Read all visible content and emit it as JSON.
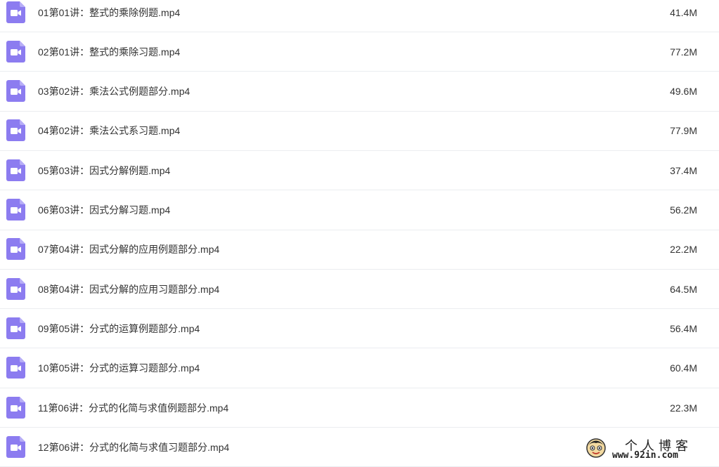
{
  "file_list": {
    "files": [
      {
        "name": "01第01讲：整式的乘除例题.mp4",
        "size": "41.4M",
        "icon": "video-file-icon"
      },
      {
        "name": "02第01讲：整式的乘除习题.mp4",
        "size": "77.2M",
        "icon": "video-file-icon"
      },
      {
        "name": "03第02讲：乘法公式例题部分.mp4",
        "size": "49.6M",
        "icon": "video-file-icon"
      },
      {
        "name": "04第02讲：乘法公式系习题.mp4",
        "size": "77.9M",
        "icon": "video-file-icon"
      },
      {
        "name": "05第03讲：因式分解例题.mp4",
        "size": "37.4M",
        "icon": "video-file-icon"
      },
      {
        "name": "06第03讲：因式分解习题.mp4",
        "size": "56.2M",
        "icon": "video-file-icon"
      },
      {
        "name": "07第04讲：因式分解的应用例题部分.mp4",
        "size": "22.2M",
        "icon": "video-file-icon"
      },
      {
        "name": "08第04讲：因式分解的应用习题部分.mp4",
        "size": "64.5M",
        "icon": "video-file-icon"
      },
      {
        "name": "09第05讲：分式的运算例题部分.mp4",
        "size": "56.4M",
        "icon": "video-file-icon"
      },
      {
        "name": "10第05讲：分式的运算习题部分.mp4",
        "size": "60.4M",
        "icon": "video-file-icon"
      },
      {
        "name": "11第06讲：分式的化简与求值例题部分.mp4",
        "size": "22.3M",
        "icon": "video-file-icon"
      },
      {
        "name": "12第06讲：分式的化简与求值习题部分.mp4",
        "size": "",
        "icon": "video-file-icon"
      }
    ]
  },
  "watermark": {
    "title": "个人博客",
    "url": "www.92in.com"
  },
  "colors": {
    "icon_purple": "#8c7cf0",
    "divider": "#ebedf0",
    "text": "#333333"
  }
}
